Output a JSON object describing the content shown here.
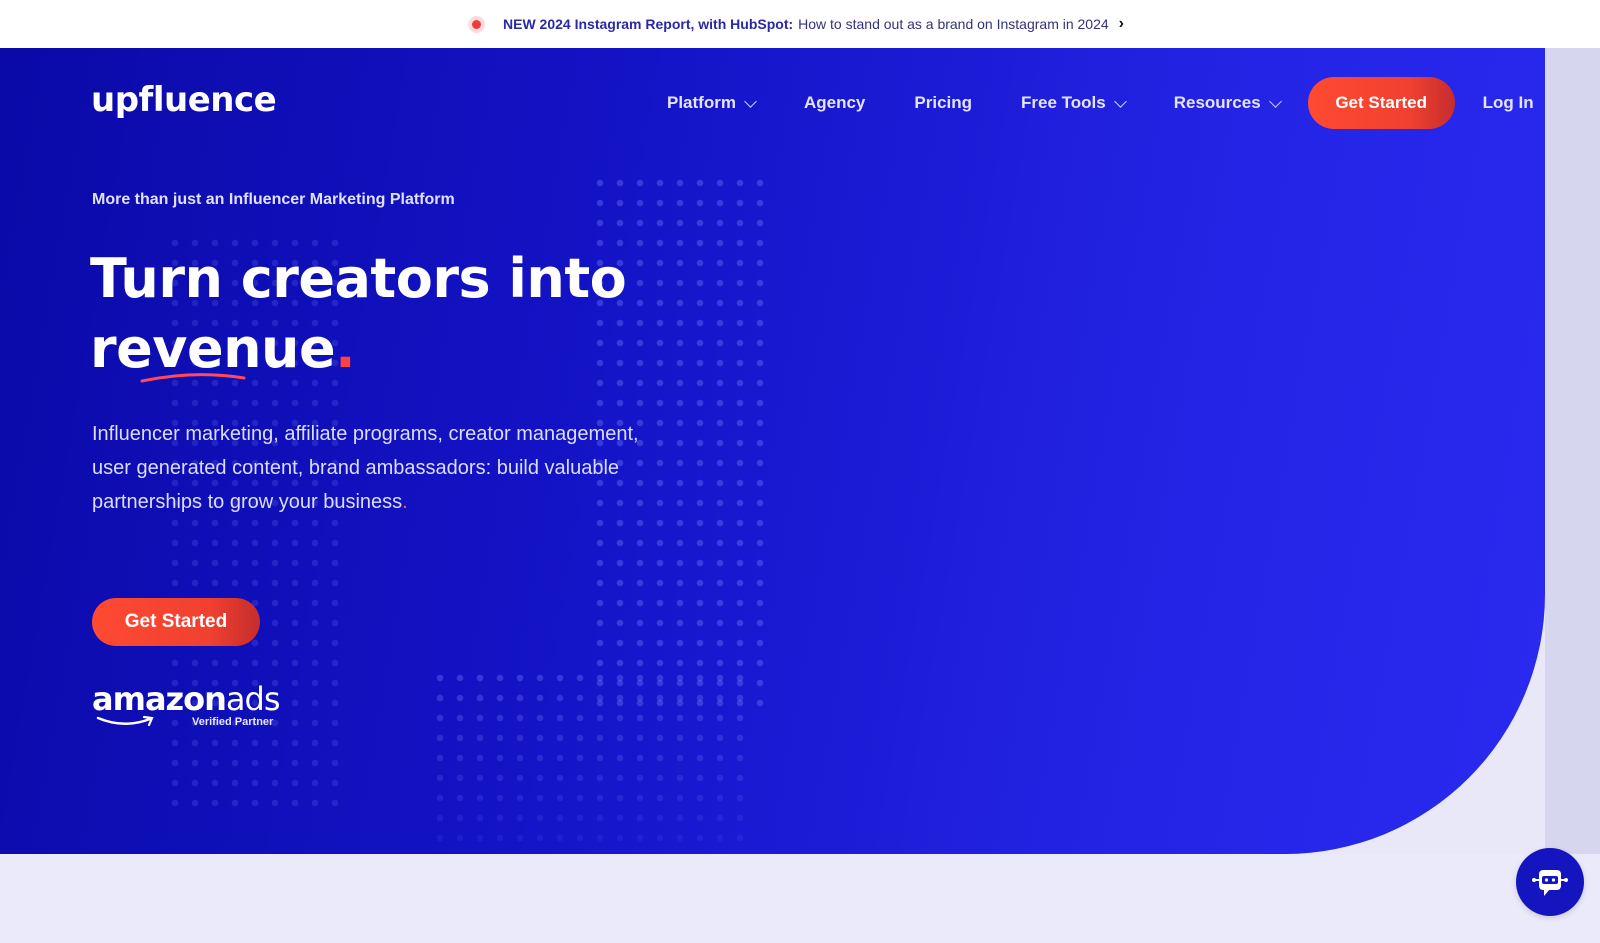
{
  "announcement": {
    "highlight": "NEW 2024 Instagram Report, with HubSpot:",
    "text": "How to stand out as a brand on Instagram in 2024",
    "chevron": "›"
  },
  "brand": {
    "logo_text": "upfluence",
    "accent_color": "#ff3d3d",
    "primary_color": "#1414c8"
  },
  "nav": {
    "items": [
      {
        "label": "Platform",
        "has_dropdown": true
      },
      {
        "label": "Agency",
        "has_dropdown": false
      },
      {
        "label": "Pricing",
        "has_dropdown": false
      },
      {
        "label": "Free Tools",
        "has_dropdown": true
      },
      {
        "label": "Resources",
        "has_dropdown": true
      }
    ],
    "cta_label": "Get Started",
    "login_label": "Log In"
  },
  "hero": {
    "kicker": "More than just an Influencer Marketing Platform",
    "headline_line1": "Turn creators into",
    "headline_word": "revenue",
    "headline_period": ".",
    "description": "Influencer marketing, affiliate programs, creator management, user generated content, brand ambassadors: build valuable partnerships to grow your business",
    "description_period": ".",
    "cta_label": "Get Started",
    "partner": {
      "brand": "amazon",
      "product": "ads",
      "badge": "Verified Partner"
    }
  },
  "chat_widget": {
    "icon": "chatbot-icon"
  }
}
